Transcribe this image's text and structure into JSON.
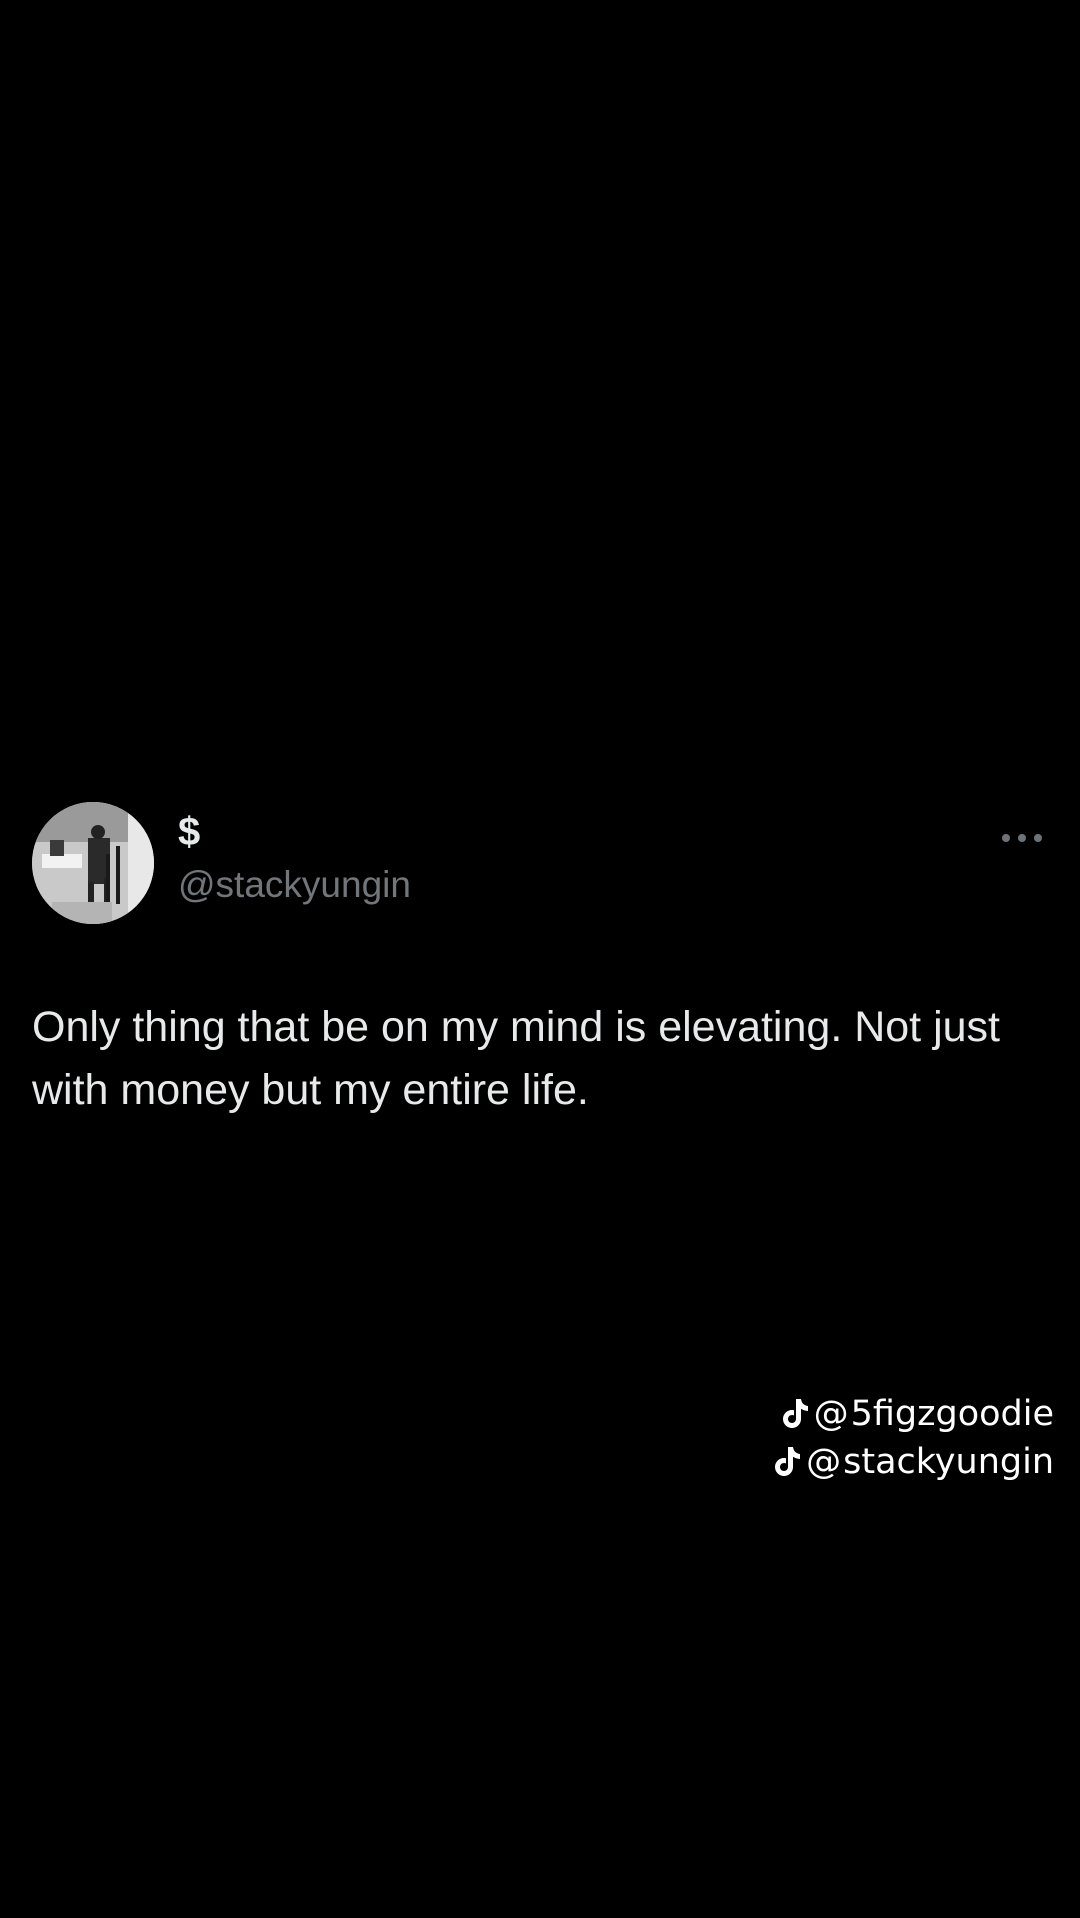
{
  "tweet": {
    "display_name": "$",
    "handle": "@stackyungin",
    "text": "Only thing that be on my mind is elevating. Not just with money but my entire life.",
    "more_icon": "more-horizontal-icon"
  },
  "credits": [
    {
      "icon": "tiktok-icon",
      "at": "@",
      "username": "5figzgoodie"
    },
    {
      "icon": "tiktok-icon",
      "at": "@",
      "username": "stackyungin"
    }
  ],
  "colors": {
    "background": "#000000",
    "text_primary": "#e7e9ea",
    "text_secondary": "#71767b",
    "credit_text": "#ffffff"
  }
}
